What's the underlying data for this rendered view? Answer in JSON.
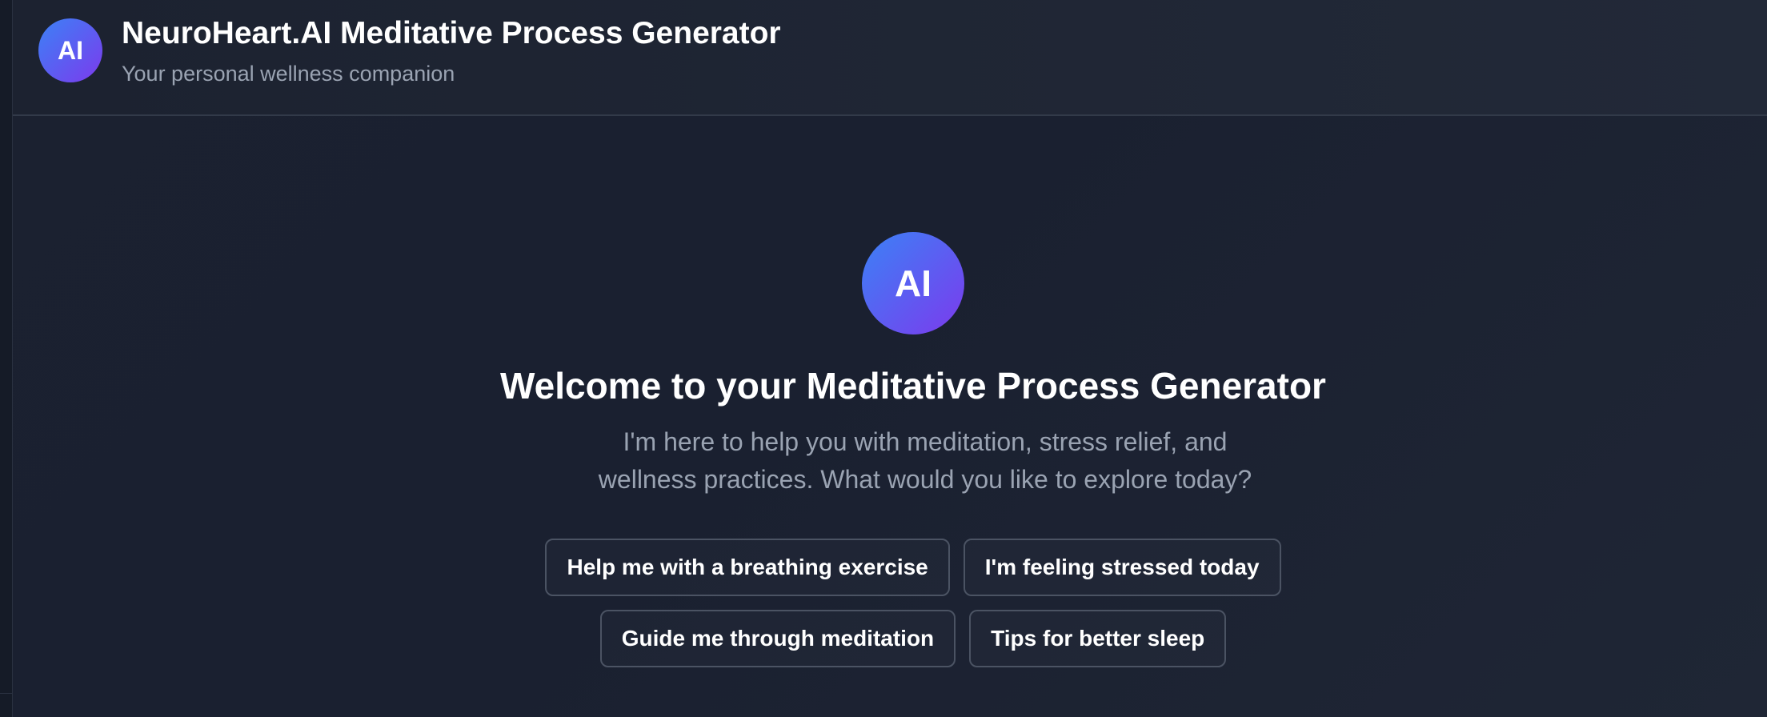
{
  "header": {
    "avatar_text": "AI",
    "title": "NeuroHeart.AI Meditative Process Generator",
    "subtitle": "Your personal wellness companion"
  },
  "welcome": {
    "avatar_text": "AI",
    "title": "Welcome to your Meditative Process Generator",
    "description": "I'm here to help you with meditation, stress relief, and wellness practices. What would you like to explore today?",
    "suggestions": [
      {
        "label": "Help me with a breathing exercise"
      },
      {
        "label": "I'm feeling stressed today"
      },
      {
        "label": "Guide me through meditation"
      },
      {
        "label": "Tips for better sleep"
      }
    ]
  },
  "colors": {
    "background": "#111827",
    "accent_gradient_start": "#3b82f6",
    "accent_gradient_end": "#7c3aed",
    "muted_text": "#9aa3b2",
    "button_border": "#4b5363"
  }
}
